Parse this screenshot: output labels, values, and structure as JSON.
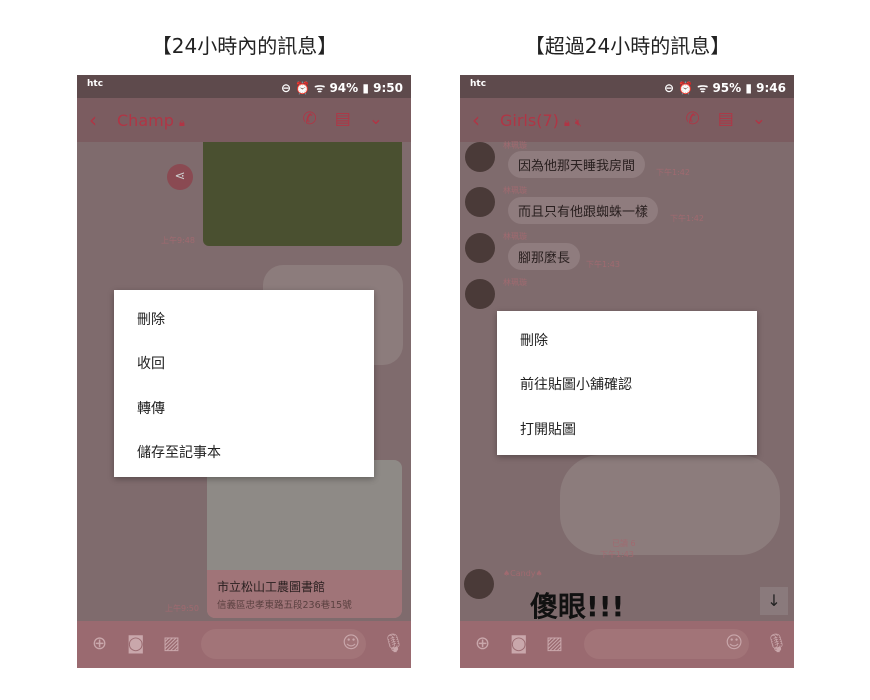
{
  "left": {
    "caption": "【24小時內的訊息】",
    "status": {
      "left": "htc",
      "battery": "94%",
      "time": "9:50"
    },
    "chat_title": "Champ",
    "times": [
      "上午9:48",
      "上午9:50"
    ],
    "map": {
      "place": "市立松山工農圖書館",
      "address": "信義區忠孝東路五段236巷15號"
    },
    "menu": [
      "刪除",
      "收回",
      "轉傳",
      "儲存至記事本"
    ]
  },
  "right": {
    "caption": "【超過24小時的訊息】",
    "status": {
      "left": "htc",
      "battery": "95%",
      "time": "9:46"
    },
    "chat_title": "Girls(7)",
    "messages": [
      {
        "name": "林珮璇",
        "text": "因為他那天睡我房間",
        "time": "下午1:42"
      },
      {
        "name": "林珮璇",
        "text": "而且只有他跟蜘蛛一樣",
        "time": "下午1:42"
      },
      {
        "name": "林珮璇",
        "text": "腳那麼長",
        "time": "下午1:43"
      },
      {
        "name": "林珮璇"
      }
    ],
    "read": "已讀 6",
    "read_time": "下午1:43",
    "sender2": "♠Candy♠",
    "sticker_text": "傻眼!!!",
    "menu": [
      "刪除",
      "前往貼圖小舖確認",
      "打開貼圖"
    ]
  },
  "colors": {
    "accent": "#b03545"
  }
}
